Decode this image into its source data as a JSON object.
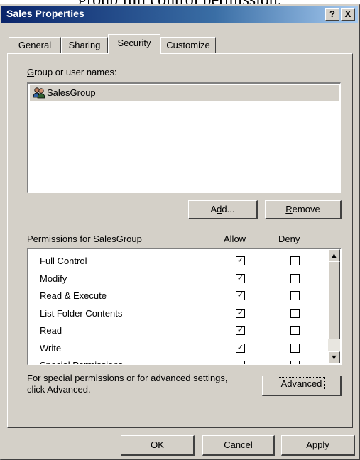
{
  "caption": "group full control permission.",
  "window": {
    "title": "Sales Properties",
    "help_btn": "?",
    "close_btn": "X"
  },
  "tabs": [
    {
      "label": "General"
    },
    {
      "label": "Sharing"
    },
    {
      "label": "Security",
      "active": true
    },
    {
      "label": "Customize"
    }
  ],
  "groups": {
    "label_prefix": "G",
    "label_rest": "roup or user names:",
    "items": [
      {
        "name": "SalesGroup",
        "icon": "users-group-icon"
      }
    ]
  },
  "buttons": {
    "add_a": "A",
    "add_u": "d",
    "add_rest": "d...",
    "remove_u": "R",
    "remove_rest": "emove",
    "advanced_pre": "Ad",
    "advanced_u": "v",
    "advanced_rest": "anced",
    "ok": "OK",
    "cancel": "Cancel",
    "apply_u": "A",
    "apply_rest": "pply"
  },
  "permissions": {
    "label_u": "P",
    "label_rest": "ermissions for SalesGroup",
    "allow_header": "Allow",
    "deny_header": "Deny",
    "rows": [
      {
        "name": "Full Control",
        "allow": true,
        "deny": false
      },
      {
        "name": "Modify",
        "allow": true,
        "deny": false
      },
      {
        "name": "Read & Execute",
        "allow": true,
        "deny": false
      },
      {
        "name": "List Folder Contents",
        "allow": true,
        "deny": false
      },
      {
        "name": "Read",
        "allow": true,
        "deny": false
      },
      {
        "name": "Write",
        "allow": true,
        "deny": false
      },
      {
        "name": "Special Permissions",
        "allow": false,
        "deny": false
      }
    ]
  },
  "advanced_text": {
    "line1": "For special permissions or for advanced settings,",
    "line2": "click Advanced."
  },
  "colors": {
    "titlebar_start": "#0a246a",
    "face": "#d4d0c8"
  }
}
